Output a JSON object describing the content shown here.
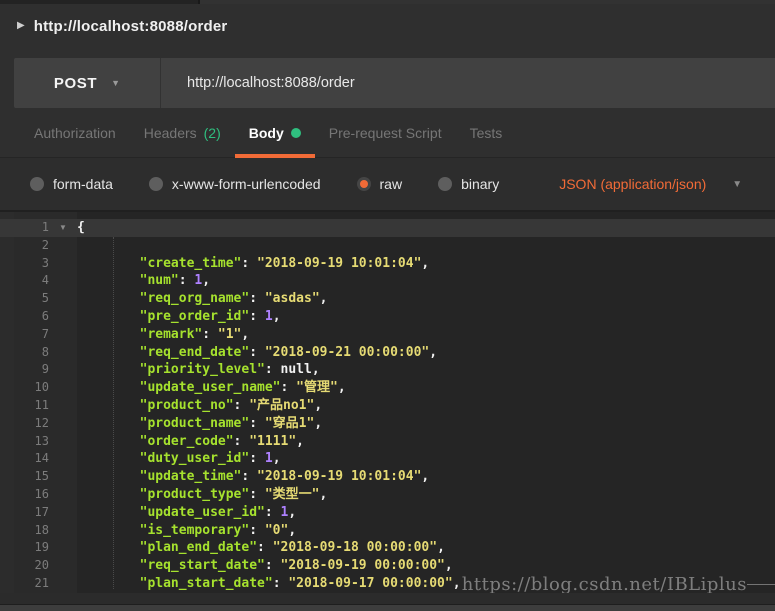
{
  "colors": {
    "accent_orange": "#f26b37",
    "green": "#2fbf7f",
    "syntax_key": "#a6e22e",
    "syntax_string": "#e6db74",
    "syntax_number": "#ae81ff",
    "editor_bg": "#252525",
    "row_bg": "#414141"
  },
  "header": {
    "collapsed_title": "http://localhost:8088/order"
  },
  "request_bar": {
    "method": "POST",
    "url": "http://localhost:8088/order"
  },
  "tabs": [
    {
      "label": "Authorization",
      "active": false
    },
    {
      "label": "Headers",
      "count": "(2)",
      "active": false
    },
    {
      "label": "Body",
      "active": true,
      "dot": true
    },
    {
      "label": "Pre-request Script",
      "active": false
    },
    {
      "label": "Tests",
      "active": false
    }
  ],
  "body_toolbar": {
    "options": [
      {
        "label": "form-data",
        "selected": false
      },
      {
        "label": "x-www-form-urlencoded",
        "selected": false
      },
      {
        "label": "raw",
        "selected": true
      },
      {
        "label": "binary",
        "selected": false
      }
    ],
    "content_type": "JSON (application/json)"
  },
  "editor": {
    "lines": [
      {
        "n": 1,
        "active": true,
        "fold": true,
        "tokens": [
          {
            "t": "pun",
            "v": "{"
          }
        ]
      },
      {
        "n": 2,
        "tokens": []
      },
      {
        "n": 3,
        "tokens": [
          {
            "t": "ws",
            "v": "        "
          },
          {
            "t": "key",
            "v": "\"create_time\""
          },
          {
            "t": "pun",
            "v": ": "
          },
          {
            "t": "str",
            "v": "\"2018-09-19 10:01:04\""
          },
          {
            "t": "pun",
            "v": ","
          }
        ]
      },
      {
        "n": 4,
        "tokens": [
          {
            "t": "ws",
            "v": "        "
          },
          {
            "t": "key",
            "v": "\"num\""
          },
          {
            "t": "pun",
            "v": ": "
          },
          {
            "t": "num",
            "v": "1"
          },
          {
            "t": "pun",
            "v": ","
          }
        ]
      },
      {
        "n": 5,
        "tokens": [
          {
            "t": "ws",
            "v": "        "
          },
          {
            "t": "key",
            "v": "\"req_org_name\""
          },
          {
            "t": "pun",
            "v": ": "
          },
          {
            "t": "str",
            "v": "\"asdas\""
          },
          {
            "t": "pun",
            "v": ","
          }
        ]
      },
      {
        "n": 6,
        "tokens": [
          {
            "t": "ws",
            "v": "        "
          },
          {
            "t": "key",
            "v": "\"pre_order_id\""
          },
          {
            "t": "pun",
            "v": ": "
          },
          {
            "t": "num",
            "v": "1"
          },
          {
            "t": "pun",
            "v": ","
          }
        ]
      },
      {
        "n": 7,
        "tokens": [
          {
            "t": "ws",
            "v": "        "
          },
          {
            "t": "key",
            "v": "\"remark\""
          },
          {
            "t": "pun",
            "v": ": "
          },
          {
            "t": "str",
            "v": "\"1\""
          },
          {
            "t": "pun",
            "v": ","
          }
        ]
      },
      {
        "n": 8,
        "tokens": [
          {
            "t": "ws",
            "v": "        "
          },
          {
            "t": "key",
            "v": "\"req_end_date\""
          },
          {
            "t": "pun",
            "v": ": "
          },
          {
            "t": "str",
            "v": "\"2018-09-21 00:00:00\""
          },
          {
            "t": "pun",
            "v": ","
          }
        ]
      },
      {
        "n": 9,
        "tokens": [
          {
            "t": "ws",
            "v": "        "
          },
          {
            "t": "key",
            "v": "\"priority_level\""
          },
          {
            "t": "pun",
            "v": ": "
          },
          {
            "t": "nul",
            "v": "null"
          },
          {
            "t": "pun",
            "v": ","
          }
        ]
      },
      {
        "n": 10,
        "tokens": [
          {
            "t": "ws",
            "v": "        "
          },
          {
            "t": "key",
            "v": "\"update_user_name\""
          },
          {
            "t": "pun",
            "v": ": "
          },
          {
            "t": "str",
            "v": "\"管理\""
          },
          {
            "t": "pun",
            "v": ","
          }
        ]
      },
      {
        "n": 11,
        "tokens": [
          {
            "t": "ws",
            "v": "        "
          },
          {
            "t": "key",
            "v": "\"product_no\""
          },
          {
            "t": "pun",
            "v": ": "
          },
          {
            "t": "str",
            "v": "\"产品no1\""
          },
          {
            "t": "pun",
            "v": ","
          }
        ]
      },
      {
        "n": 12,
        "tokens": [
          {
            "t": "ws",
            "v": "        "
          },
          {
            "t": "key",
            "v": "\"product_name\""
          },
          {
            "t": "pun",
            "v": ": "
          },
          {
            "t": "str",
            "v": "\"穿品1\""
          },
          {
            "t": "pun",
            "v": ","
          }
        ]
      },
      {
        "n": 13,
        "tokens": [
          {
            "t": "ws",
            "v": "        "
          },
          {
            "t": "key",
            "v": "\"order_code\""
          },
          {
            "t": "pun",
            "v": ": "
          },
          {
            "t": "str",
            "v": "\"1111\""
          },
          {
            "t": "pun",
            "v": ","
          }
        ]
      },
      {
        "n": 14,
        "tokens": [
          {
            "t": "ws",
            "v": "        "
          },
          {
            "t": "key",
            "v": "\"duty_user_id\""
          },
          {
            "t": "pun",
            "v": ": "
          },
          {
            "t": "num",
            "v": "1"
          },
          {
            "t": "pun",
            "v": ","
          }
        ]
      },
      {
        "n": 15,
        "tokens": [
          {
            "t": "ws",
            "v": "        "
          },
          {
            "t": "key",
            "v": "\"update_time\""
          },
          {
            "t": "pun",
            "v": ": "
          },
          {
            "t": "str",
            "v": "\"2018-09-19 10:01:04\""
          },
          {
            "t": "pun",
            "v": ","
          }
        ]
      },
      {
        "n": 16,
        "tokens": [
          {
            "t": "ws",
            "v": "        "
          },
          {
            "t": "key",
            "v": "\"product_type\""
          },
          {
            "t": "pun",
            "v": ": "
          },
          {
            "t": "str",
            "v": "\"类型一\""
          },
          {
            "t": "pun",
            "v": ","
          }
        ]
      },
      {
        "n": 17,
        "tokens": [
          {
            "t": "ws",
            "v": "        "
          },
          {
            "t": "key",
            "v": "\"update_user_id\""
          },
          {
            "t": "pun",
            "v": ": "
          },
          {
            "t": "num",
            "v": "1"
          },
          {
            "t": "pun",
            "v": ","
          }
        ]
      },
      {
        "n": 18,
        "tokens": [
          {
            "t": "ws",
            "v": "        "
          },
          {
            "t": "key",
            "v": "\"is_temporary\""
          },
          {
            "t": "pun",
            "v": ": "
          },
          {
            "t": "str",
            "v": "\"0\""
          },
          {
            "t": "pun",
            "v": ","
          }
        ]
      },
      {
        "n": 19,
        "tokens": [
          {
            "t": "ws",
            "v": "        "
          },
          {
            "t": "key",
            "v": "\"plan_end_date\""
          },
          {
            "t": "pun",
            "v": ": "
          },
          {
            "t": "str",
            "v": "\"2018-09-18 00:00:00\""
          },
          {
            "t": "pun",
            "v": ","
          }
        ]
      },
      {
        "n": 20,
        "tokens": [
          {
            "t": "ws",
            "v": "        "
          },
          {
            "t": "key",
            "v": "\"req_start_date\""
          },
          {
            "t": "pun",
            "v": ": "
          },
          {
            "t": "str",
            "v": "\"2018-09-19 00:00:00\""
          },
          {
            "t": "pun",
            "v": ","
          }
        ]
      },
      {
        "n": 21,
        "tokens": [
          {
            "t": "ws",
            "v": "        "
          },
          {
            "t": "key",
            "v": "\"plan_start_date\""
          },
          {
            "t": "pun",
            "v": ": "
          },
          {
            "t": "str",
            "v": "\"2018-09-17 00:00:00\""
          },
          {
            "t": "pun",
            "v": ","
          }
        ]
      }
    ]
  },
  "watermark": "https://blog.csdn.net/IBLiplus"
}
